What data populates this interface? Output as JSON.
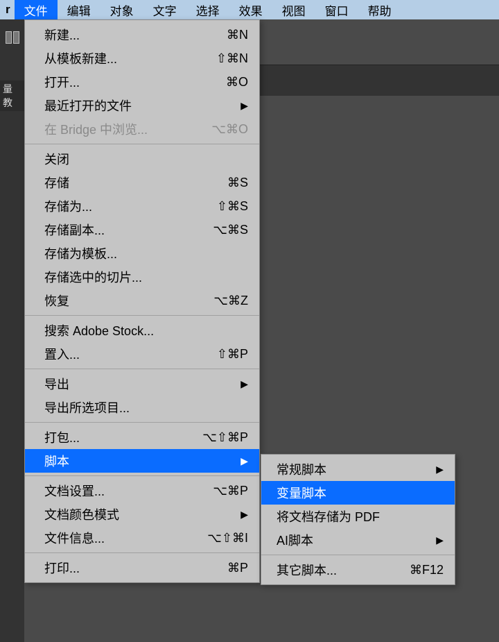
{
  "menubar": {
    "r": "r",
    "items": [
      "文件",
      "编辑",
      "对象",
      "文字",
      "选择",
      "效果",
      "视图",
      "窗口",
      "帮助"
    ]
  },
  "side_panel": "量教",
  "file_menu": {
    "group1": [
      {
        "label": "新建...",
        "shortcut": "⌘N"
      },
      {
        "label": "从模板新建...",
        "shortcut": "⇧⌘N"
      },
      {
        "label": "打开...",
        "shortcut": "⌘O"
      },
      {
        "label": "最近打开的文件",
        "arrow": true
      },
      {
        "label": "在 Bridge 中浏览...",
        "shortcut": "⌥⌘O",
        "disabled": true
      }
    ],
    "group2": [
      {
        "label": "关闭"
      },
      {
        "label": "存储",
        "shortcut": "⌘S"
      },
      {
        "label": "存储为...",
        "shortcut": "⇧⌘S"
      },
      {
        "label": "存储副本...",
        "shortcut": "⌥⌘S"
      },
      {
        "label": "存储为模板..."
      },
      {
        "label": "存储选中的切片..."
      },
      {
        "label": "恢复",
        "shortcut": "⌥⌘Z"
      }
    ],
    "group3": [
      {
        "label": "搜索 Adobe Stock..."
      },
      {
        "label": "置入...",
        "shortcut": "⇧⌘P"
      }
    ],
    "group4": [
      {
        "label": "导出",
        "arrow": true
      },
      {
        "label": "导出所选项目..."
      }
    ],
    "group5": [
      {
        "label": "打包...",
        "shortcut": "⌥⇧⌘P"
      },
      {
        "label": "脚本",
        "arrow": true,
        "highlighted": true
      }
    ],
    "group6": [
      {
        "label": "文档设置...",
        "shortcut": "⌥⌘P"
      },
      {
        "label": "文档颜色模式",
        "arrow": true
      },
      {
        "label": "文件信息...",
        "shortcut": "⌥⇧⌘I"
      }
    ],
    "group7": [
      {
        "label": "打印...",
        "shortcut": "⌘P"
      }
    ]
  },
  "scripts_submenu": {
    "group1": [
      {
        "label": "常规脚本",
        "arrow": true
      },
      {
        "label": "变量脚本",
        "highlighted": true
      },
      {
        "label": "将文档存储为 PDF"
      },
      {
        "label": "AI脚本",
        "arrow": true
      }
    ],
    "group2": [
      {
        "label": "其它脚本...",
        "shortcut": "⌘F12"
      }
    ]
  }
}
